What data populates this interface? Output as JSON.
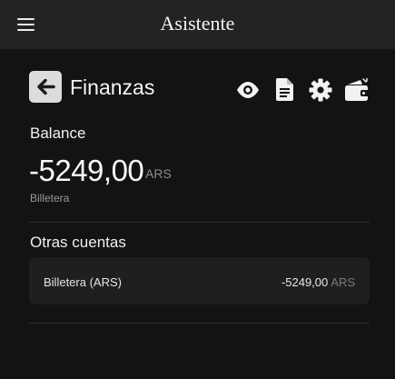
{
  "header": {
    "app_title": "Asistente",
    "menu_icon": "hamburger-menu-icon"
  },
  "page": {
    "title": "Finanzas",
    "back_icon": "arrow-left-icon",
    "actions": [
      {
        "name": "eye-icon"
      },
      {
        "name": "document-icon"
      },
      {
        "name": "gear-icon"
      },
      {
        "name": "wallet-icon"
      }
    ]
  },
  "balance": {
    "label": "Balance",
    "amount": "-5249,00",
    "currency": "ARS",
    "account": "Billetera"
  },
  "other_accounts": {
    "title": "Otras cuentas",
    "items": [
      {
        "name": "Billetera (ARS)",
        "amount": "-5249,00",
        "currency": "ARS"
      }
    ]
  },
  "colors": {
    "background": "#131313",
    "topbar": "#232323",
    "card": "#1f1f1f",
    "muted_text": "#8c8c8c"
  }
}
